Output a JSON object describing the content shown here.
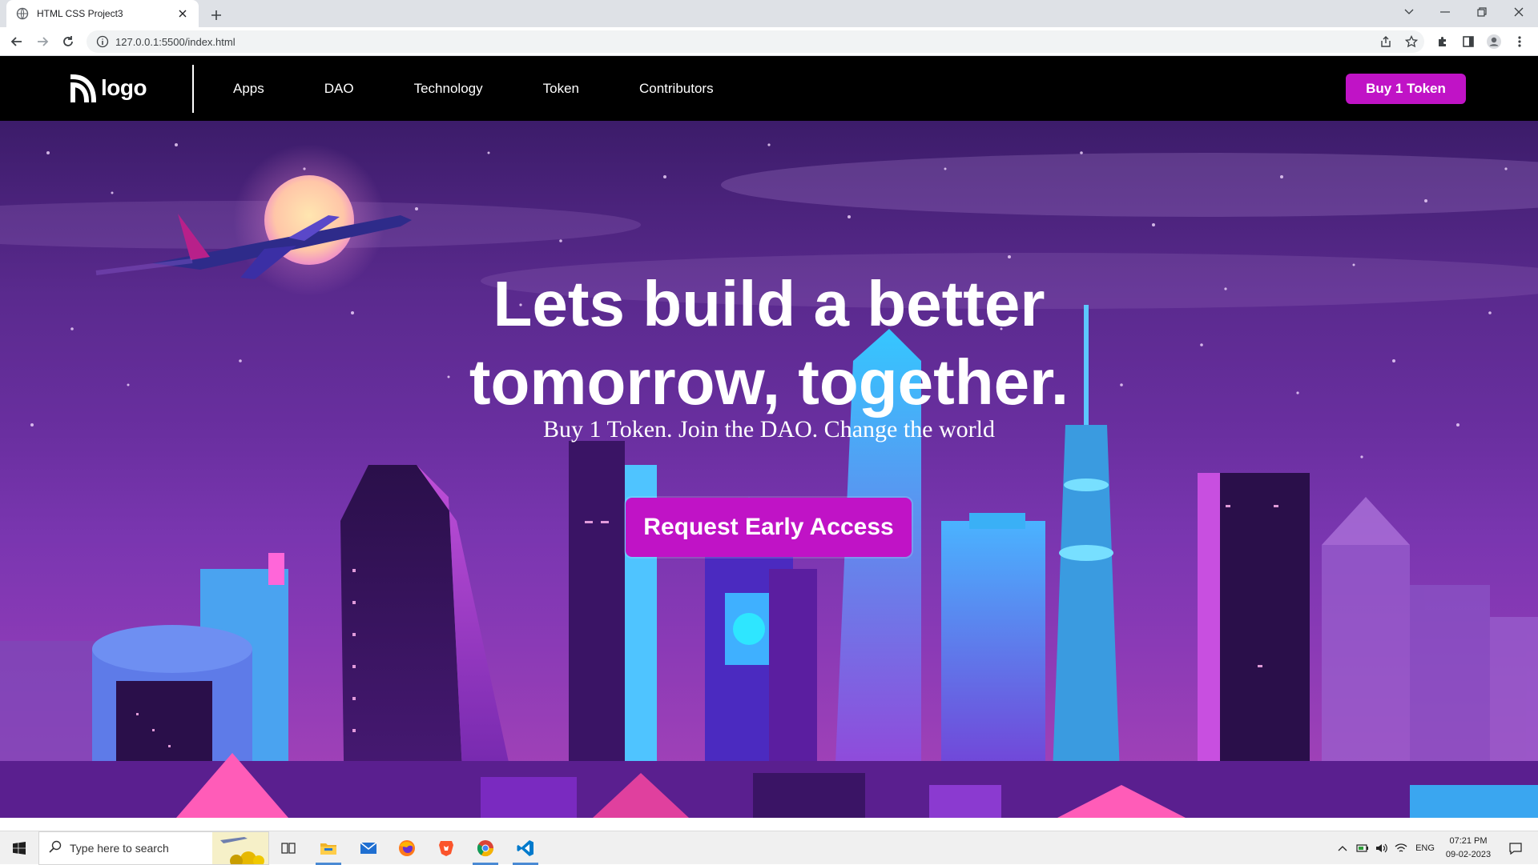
{
  "browser": {
    "tab_title": "HTML CSS Project3",
    "url": "127.0.0.1:5500/index.html"
  },
  "navbar": {
    "logo_text": "logo",
    "links": [
      "Apps",
      "DAO",
      "Technology",
      "Token",
      "Contributors"
    ],
    "buy_button": "Buy 1 Token"
  },
  "hero": {
    "title_line1": "Lets build a better",
    "title_line2": "tomorrow, together.",
    "subtitle": "Buy 1 Token. Join the DAO. Change the world",
    "cta": "Request Early Access"
  },
  "taskbar": {
    "search_placeholder": "Type here to search",
    "language": "ENG",
    "time": "07:21 PM",
    "date": "09-02-2023"
  },
  "colors": {
    "accent": "#c013c6",
    "navbar_bg": "#000000"
  },
  "icons": [
    "globe-icon",
    "close-icon",
    "plus-icon",
    "back-icon",
    "forward-icon",
    "reload-icon",
    "info-icon",
    "share-icon",
    "star-icon",
    "extensions-icon",
    "sidepanel-icon",
    "profile-icon",
    "menu-icon",
    "windows-icon",
    "search-icon",
    "taskview-icon",
    "file-explorer-icon",
    "mail-icon",
    "firefox-icon",
    "brave-icon",
    "chrome-icon",
    "vscode-icon",
    "notification-icon"
  ]
}
